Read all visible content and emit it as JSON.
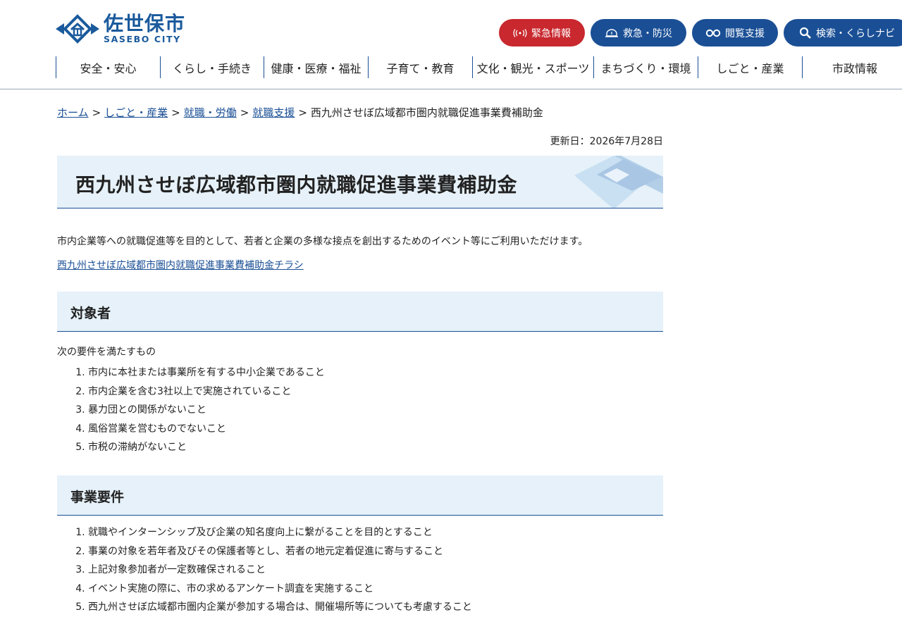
{
  "logo": {
    "jp": "佐世保市",
    "en": "SASEBO CITY"
  },
  "top_buttons": [
    {
      "label": "緊急情報",
      "icon": "broadcast-icon",
      "color": "#c8282e"
    },
    {
      "label": "救急・防災",
      "icon": "siren-icon",
      "color": "#1a4f95"
    },
    {
      "label": "閲覧支援",
      "icon": "glasses-icon",
      "color": "#1a4f95"
    },
    {
      "label": "検索・くらしナビ",
      "icon": "search-icon",
      "color": "#1a4f95"
    }
  ],
  "global_nav": [
    {
      "label": "安全・安心"
    },
    {
      "label": "くらし・手続き"
    },
    {
      "label": "健康・医療・福祉"
    },
    {
      "label": "子育て・教育"
    },
    {
      "label": "文化・観光・スポーツ"
    },
    {
      "label": "まちづくり・環境"
    },
    {
      "label": "しごと・産業"
    },
    {
      "label": "市政情報"
    }
  ],
  "breadcrumb": {
    "links": [
      "ホーム",
      "しごと・産業",
      "就職・労働",
      "就職支援"
    ],
    "separator": ">",
    "current": "西九州させぼ広域都市圏内就職促進事業費補助金"
  },
  "updated": "更新日：2026年7月28日",
  "page_title": "西九州させぼ広域都市圏内就職促進事業費補助金",
  "lead": "市内企業等への就職促進等を目的として、若者と企業の多様な接点を創出するためのイベント等にご利用いただけます。",
  "flyer_link": "西九州させぼ広域都市圏内就職促進事業費補助金チラシ",
  "section_target": {
    "heading": "対象者",
    "intro": "次の要件を満たすもの",
    "items": [
      "市内に本社または事業所を有する中小企業であること",
      "市内企業を含む3社以上で実施されていること",
      "暴力団との関係がないこと",
      "風俗営業を営むものでないこと",
      "市税の滞納がないこと"
    ]
  },
  "section_requirements": {
    "heading": "事業要件",
    "items": [
      "就職やインターンシップ及び企業の知名度向上に繋がることを目的とすること",
      "事業の対象を若年者及びその保護者等とし、若者の地元定着促進に寄与すること",
      "上記対象参加者が一定数確保されること",
      "イベント実施の際に、市の求めるアンケート調査を実施すること",
      "西九州させぼ広域都市圏内企業が参加する場合は、開催場所等についても考慮すること"
    ]
  }
}
